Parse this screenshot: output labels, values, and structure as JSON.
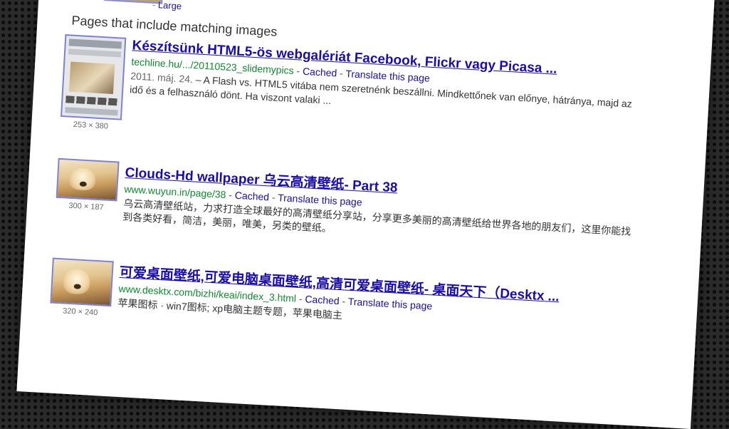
{
  "top_strip": {
    "sep": "-",
    "size": "Large"
  },
  "section_heading": "Pages that include matching images",
  "results": [
    {
      "title": "Készítsünk HTML5-ös webgalériát Facebook, Flickr vagy Picasa ...",
      "url": "techline.hu/.../20110523_slidemypics",
      "cached": "Cached",
      "translate": "Translate this page",
      "date": "2011. máj. 24.",
      "snippet": "– A Flash vs. HTML5 vitába nem szeretnénk beszállni. Mindkettőnek van előnye, hátránya, majd az idő és a felhasználó dönt. Ha viszont valaki ...",
      "dims": "253 × 380",
      "thumb_icon": "phone-screenshot-thumbnail"
    },
    {
      "title": "Clouds-Hd wallpaper 乌云高清壁纸- Part 38",
      "url": "www.wuyun.in/page/38",
      "cached": "Cached",
      "translate": "Translate this page",
      "snippet": "乌云高清壁纸站，力求打造全球最好的高清壁纸分享站，分享更多美丽的高清壁纸给世界各地的朋友们，这里你能找到各类好看，简洁，美丽，唯美，另类的壁纸。",
      "dims": "300 × 187",
      "thumb_icon": "dog-photo-thumbnail"
    },
    {
      "title": "可爱桌面壁纸,可爱电脑桌面壁纸,高清可爱桌面壁纸- 桌面天下（Desktx ...",
      "url": "www.desktx.com/bizhi/keai/index_3.html",
      "cached": "Cached",
      "translate": "Translate this page",
      "snippet": "苹果图标 · win7图标; xp电脑主题专题，苹果电脑主",
      "dims": "320 × 240",
      "thumb_icon": "dog-photo-thumbnail"
    }
  ],
  "colors": {
    "link": "#1a0dab",
    "url": "#0f8a2e",
    "thumb_border": "#7d82d8",
    "background": "#2b2b2b"
  }
}
